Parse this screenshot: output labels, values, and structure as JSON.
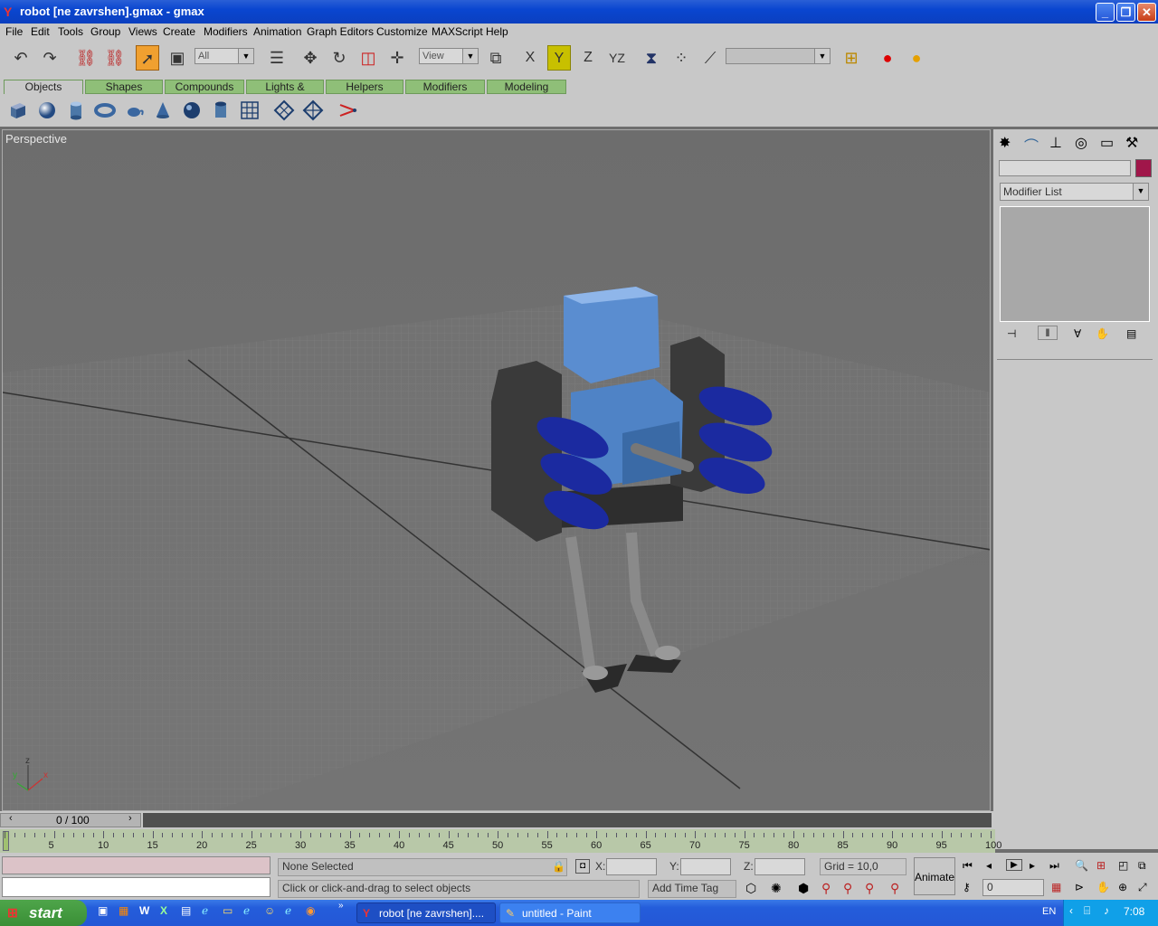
{
  "window": {
    "title": "robot [ne zavrshen].gmax - gmax",
    "controls": [
      "minimize-icon",
      "restore-icon",
      "close-icon"
    ]
  },
  "menu": [
    "File",
    "Edit",
    "Tools",
    "Group",
    "Views",
    "Create",
    "Modifiers",
    "Animation",
    "Graph Editors",
    "Customize",
    "MAXScript",
    "Help"
  ],
  "toolbar": {
    "selection_filter": "All",
    "coord_system": "View",
    "axis_x": "X",
    "axis_y": "Y",
    "axis_z": "Z",
    "axis_yz": "YZ",
    "named_selection": ""
  },
  "tabs": [
    "Objects",
    "Shapes",
    "Compounds",
    "Lights & Cameras",
    "Helpers",
    "Modifiers",
    "Modeling"
  ],
  "active_tab": "Objects",
  "viewport": {
    "label": "Perspective",
    "axis_x": "x",
    "axis_y": "y",
    "axis_z": "z"
  },
  "command_panel": {
    "object_name": "",
    "modifier_list": "Modifier List",
    "object_color": "#a0164a"
  },
  "timeline": {
    "frame_display": "0 / 100",
    "ticks": [
      "5",
      "10",
      "15",
      "20",
      "25",
      "30",
      "35",
      "40",
      "45",
      "50",
      "55",
      "60",
      "65",
      "70",
      "75",
      "80",
      "85",
      "90",
      "95",
      "100"
    ]
  },
  "status": {
    "selection": "None Selected",
    "prompt": "Click or click-and-drag to select objects",
    "x_label": "X:",
    "y_label": "Y:",
    "z_label": "Z:",
    "grid": "Grid = 10,0",
    "animate": "Animate",
    "add_time_tag": "Add Time Tag",
    "frame_value": "0"
  },
  "taskbar": {
    "start": "start",
    "tasks": [
      "robot [ne zavrshen]....",
      "untitled - Paint"
    ],
    "lang": "EN",
    "time": "7:08"
  }
}
